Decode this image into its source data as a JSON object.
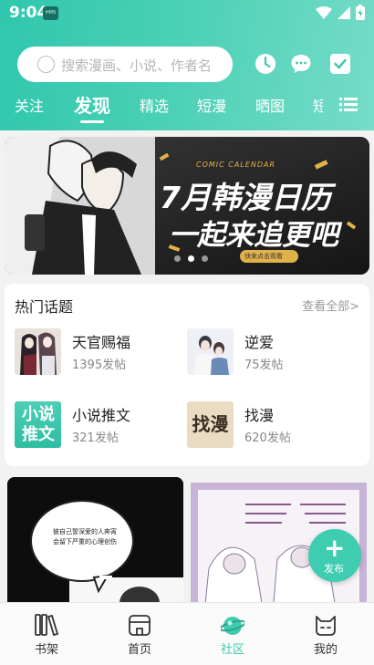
{
  "status_bar": {
    "time": "9:04",
    "badge": "HMS"
  },
  "search": {
    "placeholder": "搜索漫画、小说、作者名"
  },
  "header_icons": [
    "clock-icon",
    "chat-icon",
    "checkin-icon"
  ],
  "tabs": [
    {
      "label": "关注",
      "active": false
    },
    {
      "label": "发现",
      "active": true
    },
    {
      "label": "精选",
      "active": false
    },
    {
      "label": "短漫",
      "active": false
    },
    {
      "label": "晒图",
      "active": false
    },
    {
      "label": "短",
      "active": false
    }
  ],
  "banner": {
    "tag": "COMIC CALENDAR",
    "headline_line1": "7月韩漫日历",
    "headline_line2": "一起来追更吧",
    "button": "快来点击观看",
    "dots": 3,
    "active_dot": 1
  },
  "hot_topics": {
    "title": "热门话题",
    "more": "查看全部>",
    "items": [
      {
        "name": "天官赐福",
        "count": "1395发帖"
      },
      {
        "name": "逆爱",
        "count": "75发帖"
      },
      {
        "name": "小说推文",
        "count": "321发帖",
        "thumb_text": "小说推文"
      },
      {
        "name": "找漫",
        "count": "620发帖",
        "thumb_text": "找漫"
      }
    ]
  },
  "feed": {
    "card1_bubble": "彼自己誓深爱的人奔宵会留下严重的心理创伤"
  },
  "fab": {
    "label": "发布",
    "plus": "+"
  },
  "bottom_nav": [
    {
      "label": "书架",
      "icon": "bookshelf-icon",
      "active": false
    },
    {
      "label": "首页",
      "icon": "home-icon",
      "active": false
    },
    {
      "label": "社区",
      "icon": "community-icon",
      "active": true
    },
    {
      "label": "我的",
      "icon": "profile-icon",
      "active": false
    }
  ],
  "colors": {
    "accent": "#3ecdb0",
    "header_start": "#2fc7ae",
    "header_end": "#76dcc8"
  }
}
